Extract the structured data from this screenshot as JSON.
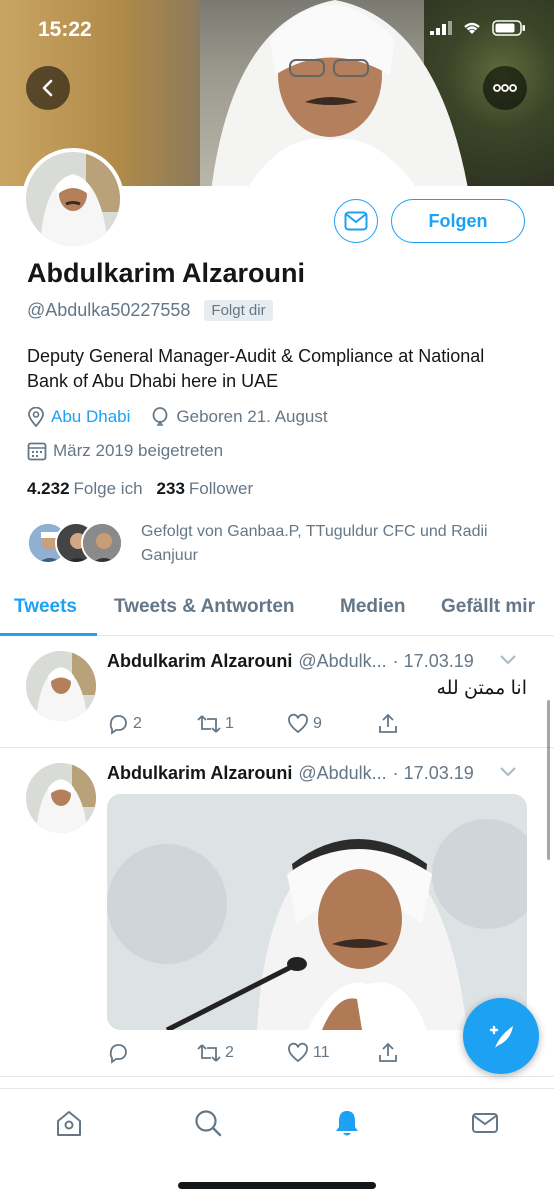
{
  "status_bar": {
    "time": "15:22"
  },
  "profile": {
    "name": "Abdulkarim Alzarouni",
    "handle": "@Abdulka50227558",
    "follows_you_badge": "Folgt dir",
    "bio": "Deputy General Manager-Audit & Compliance at National Bank of Abu Dhabi here in UAE",
    "location": "Abu Dhabi",
    "birthday": "Geboren 21. August",
    "joined": "März 2019 beigetreten",
    "following_count": "4.232",
    "following_label": "Folge ich",
    "followers_count": "233",
    "followers_label": "Follower",
    "followed_by_text": "Gefolgt von Ganbaa.P, TTuguldur CFC und Radii Ganjuur",
    "follow_button": "Folgen"
  },
  "tabs": [
    {
      "label": "Tweets",
      "active": true
    },
    {
      "label": "Tweets & Antworten",
      "active": false
    },
    {
      "label": "Medien",
      "active": false
    },
    {
      "label": "Gefällt mir",
      "active": false
    }
  ],
  "tweets": [
    {
      "name": "Abdulkarim Alzarouni",
      "handle": "@Abdulk...",
      "date": "· 17.03.19",
      "text": "انا ممتن لله",
      "replies": "2",
      "retweets": "1",
      "likes": "9"
    },
    {
      "name": "Abdulkarim Alzarouni",
      "handle": "@Abdulk...",
      "date": "· 17.03.19",
      "has_media": true,
      "replies": "",
      "retweets": "2",
      "likes": "11"
    }
  ],
  "colors": {
    "accent": "#1da1f2",
    "text": "#14171a",
    "secondary": "#657786",
    "border": "#e1e8ed"
  },
  "icons": [
    "back-arrow-icon",
    "more-icon",
    "mail-icon",
    "location-icon",
    "balloon-icon",
    "calendar-icon",
    "reply-icon",
    "retweet-icon",
    "like-icon",
    "share-icon",
    "compose-icon",
    "home-icon",
    "search-icon",
    "notifications-icon",
    "messages-icon"
  ]
}
